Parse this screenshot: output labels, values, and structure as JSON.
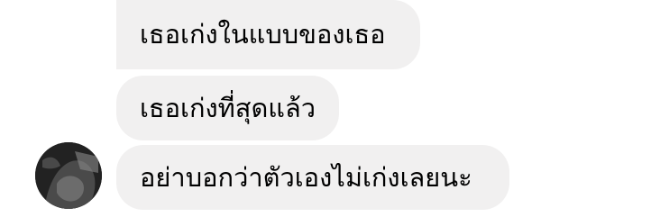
{
  "messages": [
    {
      "text": "เธอเก่งในแบบของเธอ"
    },
    {
      "text": "เธอเก่งที่สุดแล้ว"
    },
    {
      "text": "อย่าบอกว่าตัวเองไม่เก่งเลยนะ"
    }
  ],
  "colors": {
    "bubble_background": "#f1f0f0",
    "text": "#000000",
    "page_background": "#ffffff"
  }
}
